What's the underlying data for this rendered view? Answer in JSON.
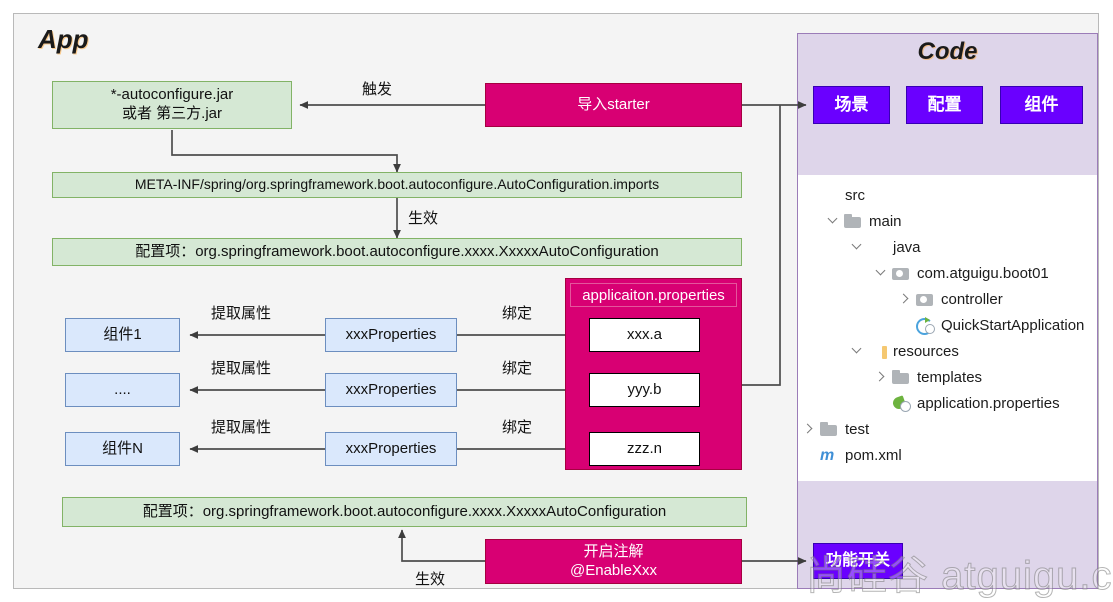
{
  "panels": {
    "app_title": "App",
    "code_title": "Code"
  },
  "app": {
    "jar_box": "*-autoconfigure.jar\n或者 第三方.jar",
    "import_starter": "导入starter",
    "trigger_label": "触发",
    "imports_file": "META-INF/spring/org.springframework.boot.autoconfigure.AutoConfiguration.imports",
    "effective_label_top": "生效",
    "config_item_top": "配置项：org.springframework.boot.autoconfigure.xxxx.XxxxxAutoConfiguration",
    "config_item_bottom": "配置项：org.springframework.boot.autoconfigure.xxxx.XxxxxAutoConfiguration",
    "effective_label_bottom": "生效",
    "enable_annotation": "开启注解\n@EnableXxx",
    "properties_panel_title": "applicaiton.properties",
    "rows": [
      {
        "component": "组件1",
        "extract_label": "提取属性",
        "properties_class": "xxxProperties",
        "bind_label": "绑定",
        "property_key": "xxx.a"
      },
      {
        "component": "....",
        "extract_label": "提取属性",
        "properties_class": "xxxProperties",
        "bind_label": "绑定",
        "property_key": "yyy.b"
      },
      {
        "component": "组件N",
        "extract_label": "提取属性",
        "properties_class": "xxxProperties",
        "bind_label": "绑定",
        "property_key": "zzz.n"
      }
    ]
  },
  "code": {
    "buttons": [
      {
        "label": "场景"
      },
      {
        "label": "配置"
      },
      {
        "label": "组件"
      }
    ],
    "feature_switch": "功能开关",
    "tree": [
      {
        "indent": 0,
        "chevron": "none",
        "icon": "folder-src",
        "label": "src"
      },
      {
        "indent": 1,
        "chevron": "open",
        "icon": "folder",
        "label": "main"
      },
      {
        "indent": 2,
        "chevron": "open",
        "icon": "folder-blue",
        "label": "java"
      },
      {
        "indent": 3,
        "chevron": "open",
        "icon": "pkg",
        "label": "com.atguigu.boot01"
      },
      {
        "indent": 4,
        "chevron": "closed",
        "icon": "pkg",
        "label": "controller"
      },
      {
        "indent": 4,
        "chevron": "none",
        "icon": "cls",
        "label": "QuickStartApplication"
      },
      {
        "indent": 2,
        "chevron": "open",
        "icon": "folder-res",
        "label": "resources"
      },
      {
        "indent": 3,
        "chevron": "closed",
        "icon": "folder",
        "label": "templates"
      },
      {
        "indent": 3,
        "chevron": "none",
        "icon": "spring",
        "label": "application.properties"
      },
      {
        "indent": 0,
        "chevron": "closed",
        "icon": "folder",
        "label": "test"
      },
      {
        "indent": 0,
        "chevron": "none",
        "icon": "maven",
        "label": "pom.xml"
      }
    ]
  },
  "watermark": {
    "text": "尚硅谷 atguigu.com"
  },
  "colors": {
    "green_fill": "#d5e8d4",
    "green_stroke": "#82b366",
    "blue_fill": "#dae8fc",
    "blue_stroke": "#6c8ebf",
    "magenta_fill": "#d80073",
    "violet_fill": "#6a00ff",
    "code_panel_fill": "#ded5ea",
    "app_panel_fill": "#f4f4f4",
    "edge_stroke": "#4d4d4d"
  }
}
